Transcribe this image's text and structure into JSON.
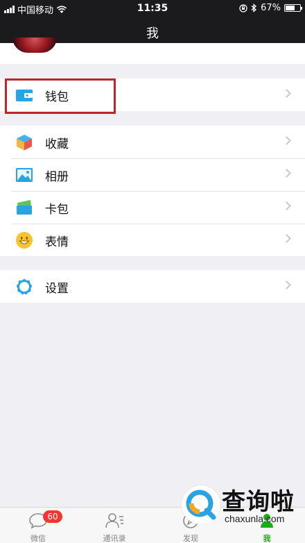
{
  "status_bar": {
    "carrier": "中国移动",
    "time": "11:35",
    "battery": "67%",
    "battery_level": 0.67,
    "icons": [
      "signal-icon",
      "wifi-icon",
      "orientation-lock-icon",
      "bluetooth-icon",
      "battery-icon"
    ]
  },
  "nav": {
    "title": "我"
  },
  "menu": {
    "wallet": {
      "label": "钱包",
      "icon": "wallet-icon",
      "icon_color": "#2aa3e3"
    },
    "group2": [
      {
        "label": "收藏",
        "icon": "favorites-cube-icon"
      },
      {
        "label": "相册",
        "icon": "album-icon"
      },
      {
        "label": "卡包",
        "icon": "card-pack-icon"
      },
      {
        "label": "表情",
        "icon": "sticker-smiley-icon"
      }
    ],
    "settings": {
      "label": "设置",
      "icon": "settings-gear-icon",
      "icon_color": "#2aa3e3"
    }
  },
  "tabbar": {
    "tabs": [
      {
        "label": "微信",
        "icon": "chat-icon",
        "badge": "60"
      },
      {
        "label": "通讯录",
        "icon": "contacts-icon"
      },
      {
        "label": "发现",
        "icon": "discover-icon"
      },
      {
        "label": "我",
        "icon": "me-icon",
        "active": true
      }
    ],
    "active_color": "#1aad19"
  },
  "watermark": {
    "main": "查询啦",
    "sub": "chaxunla.com"
  }
}
